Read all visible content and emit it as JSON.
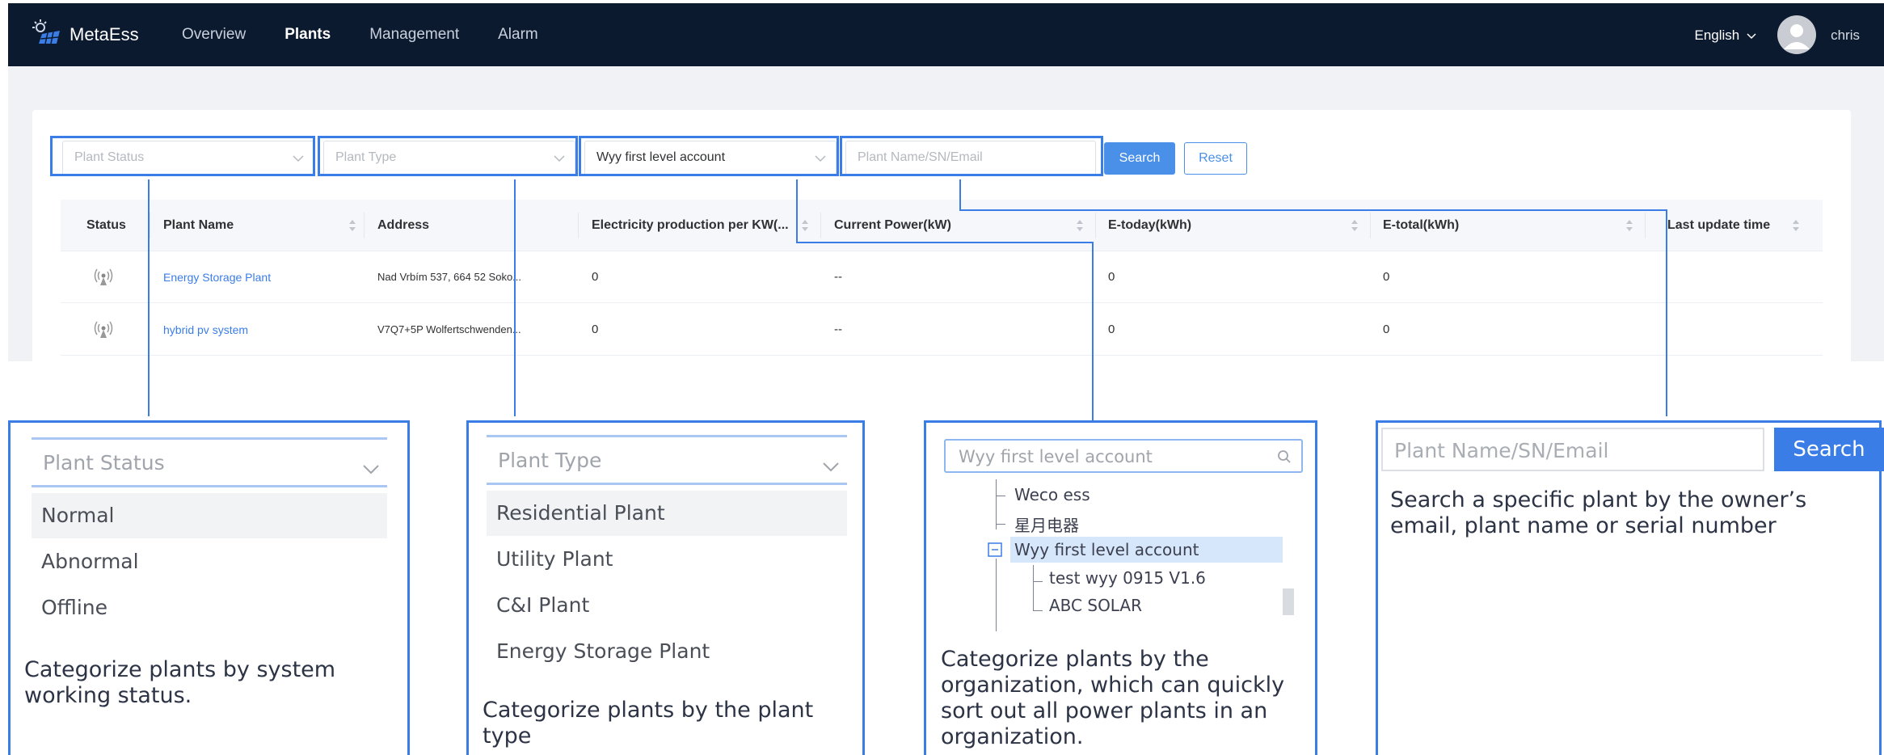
{
  "app": {
    "brand": "MetaEss",
    "nav": [
      "Overview",
      "Plants",
      "Management",
      "Alarm"
    ],
    "active_nav": "Plants",
    "language": "English",
    "username": "chris"
  },
  "filters": {
    "plant_status_placeholder": "Plant Status",
    "plant_type_placeholder": "Plant Type",
    "account_value": "Wyy first level account",
    "search_placeholder": "Plant Name/SN/Email",
    "search_label": "Search",
    "reset_label": "Reset"
  },
  "table": {
    "headers": [
      "Status",
      "Plant Name",
      "Address",
      "Electricity production per KW(...",
      "Current Power(kW)",
      "E-today(kWh)",
      "E-total(kWh)",
      "Last update time"
    ],
    "rows": [
      {
        "name": "Energy Storage Plant",
        "address": "Nad Vrbím 537, 664 52 Soko...",
        "production": "0",
        "power": "--",
        "today": "0",
        "total": "0",
        "updated": ""
      },
      {
        "name": "hybrid pv system",
        "address": "V7Q7+5P Wolfertschwenden...",
        "production": "0",
        "power": "--",
        "today": "0",
        "total": "0",
        "updated": ""
      }
    ]
  },
  "callouts": {
    "status": {
      "placeholder": "Plant Status",
      "options": [
        "Normal",
        "Abnormal",
        "Offline"
      ],
      "caption": "Categorize plants by system working status."
    },
    "type": {
      "placeholder": "Plant Type",
      "options": [
        "Residential Plant",
        "Utility Plant",
        "C&I Plant",
        "Energy Storage Plant"
      ],
      "caption": "Categorize plants by the plant type"
    },
    "org": {
      "placeholder": "Wyy first level account",
      "nodes": [
        "Weco ess",
        "星月电器",
        "Wyy first level account",
        "test wyy 0915 V1.6",
        "ABC SOLAR"
      ],
      "caption": "Categorize plants by the organization, which can quickly sort out all power plants in an organization."
    },
    "search": {
      "placeholder": "Plant Name/SN/Email",
      "button": "Search",
      "caption": "Search a specific plant by the owner’s email, plant name or serial number"
    }
  },
  "colors": {
    "accent": "#3a7de6",
    "topbar": "#0c1a2f",
    "button": "#4a90e8"
  },
  "icons": [
    "solar-logo-icon",
    "chevron-down-icon",
    "sort-icon",
    "signal-status-icon",
    "search-icon",
    "collapse-icon",
    "user-avatar-icon"
  ]
}
